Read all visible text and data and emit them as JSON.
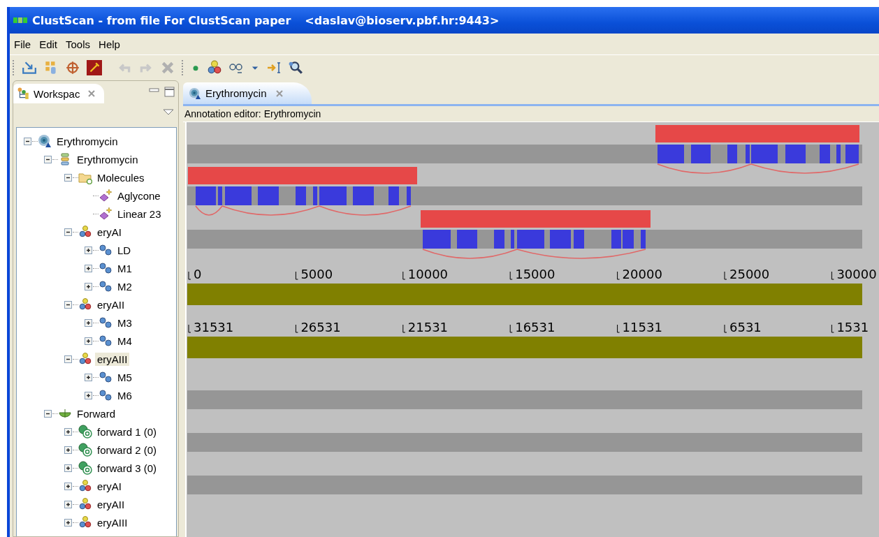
{
  "window": {
    "title": "ClustScan - from file For ClustScan paper",
    "server": "<daslav@bioserv.pbf.hr:9443>"
  },
  "menu": [
    "File",
    "Edit",
    "Tools",
    "Help"
  ],
  "workspace_view": {
    "title": "Workspac"
  },
  "tree": [
    {
      "label": "Erythromycin",
      "kind": "cluster",
      "expanded": true,
      "selected": false,
      "children": [
        {
          "label": "Erythromycin",
          "kind": "list",
          "expanded": true,
          "selected": false,
          "children": [
            {
              "label": "Molecules",
              "kind": "folder",
              "expanded": true,
              "selected": false,
              "children": [
                {
                  "label": "Aglycone",
                  "kind": "molecule",
                  "selected": false
                },
                {
                  "label": "Linear 23",
                  "kind": "molecule",
                  "selected": false
                }
              ]
            },
            {
              "label": "eryAI",
              "kind": "domains",
              "expanded": true,
              "selected": false,
              "children": [
                {
                  "label": "LD",
                  "kind": "module",
                  "expanded": false,
                  "selected": false
                },
                {
                  "label": "M1",
                  "kind": "module",
                  "expanded": false,
                  "selected": false
                },
                {
                  "label": "M2",
                  "kind": "module",
                  "expanded": false,
                  "selected": false
                }
              ]
            },
            {
              "label": "eryAII",
              "kind": "domains",
              "expanded": true,
              "selected": false,
              "children": [
                {
                  "label": "M3",
                  "kind": "module",
                  "expanded": false,
                  "selected": false
                },
                {
                  "label": "M4",
                  "kind": "module",
                  "expanded": false,
                  "selected": false
                }
              ]
            },
            {
              "label": "eryAIII",
              "kind": "domains",
              "expanded": true,
              "selected": true,
              "children": [
                {
                  "label": "M5",
                  "kind": "module",
                  "expanded": false,
                  "selected": false
                },
                {
                  "label": "M6",
                  "kind": "module",
                  "expanded": false,
                  "selected": false
                }
              ]
            }
          ]
        },
        {
          "label": "Forward",
          "kind": "forward",
          "expanded": true,
          "selected": false,
          "children": [
            {
              "label": "forward 1 (0)",
              "kind": "search",
              "expanded": false,
              "selected": false
            },
            {
              "label": "forward 2 (0)",
              "kind": "search",
              "expanded": false,
              "selected": false
            },
            {
              "label": "forward 3 (0)",
              "kind": "search",
              "expanded": false,
              "selected": false
            },
            {
              "label": "eryAI",
              "kind": "domains",
              "expanded": false,
              "selected": false
            },
            {
              "label": "eryAII",
              "kind": "domains",
              "expanded": false,
              "selected": false
            },
            {
              "label": "eryAIII",
              "kind": "domains",
              "expanded": false,
              "selected": false
            }
          ]
        }
      ]
    }
  ],
  "editor": {
    "tab": "Erythromycin",
    "header": "Annotation editor: Erythromycin",
    "forward_ruler": [
      "0",
      "5000",
      "10000",
      "15000",
      "20000",
      "25000",
      "30000"
    ],
    "reverse_ruler": [
      "31531",
      "26531",
      "21531",
      "16531",
      "11531",
      "6531",
      "1531"
    ]
  }
}
